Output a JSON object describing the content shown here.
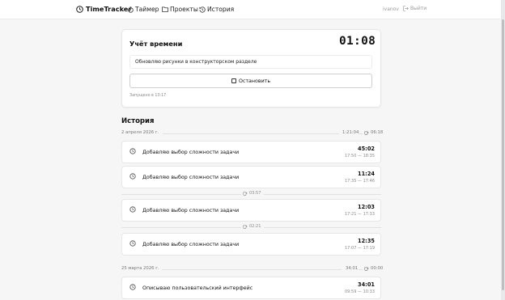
{
  "header": {
    "brand": "TimeTracker",
    "nav": {
      "timer": "Таймер",
      "projects": "Проекты",
      "history": "История"
    },
    "user": "ivanov",
    "logout": "Выйти"
  },
  "timer_card": {
    "title": "Учёт времени",
    "clock": "01:08",
    "description_value": "Обновляю рисунки в конструкторском разделе",
    "stop_label": "Остановить",
    "started_at": "Запущено в 13:17"
  },
  "history": {
    "title": "История",
    "days": [
      {
        "date": "2 апреля 2026 г.",
        "total": "1:21:04",
        "break_total": "06:18",
        "entries": [
          {
            "task": "Добавляю выбор сложности задачи",
            "duration": "45:02",
            "range": "17:50 — 18:35"
          },
          {
            "task": "Добавляю выбор сложности задачи",
            "duration": "11:24",
            "range": "17:35 — 17:46"
          },
          {
            "break": "03:57"
          },
          {
            "task": "Добавляю выбор сложности задачи",
            "duration": "12:03",
            "range": "17:21 — 17:33"
          },
          {
            "break": "02:21"
          },
          {
            "task": "Добавляю выбор сложности задачи",
            "duration": "12:35",
            "range": "17:07 — 17:19"
          }
        ]
      },
      {
        "date": "25 марта 2026 г.",
        "total": "34:01",
        "break_total": "00:00",
        "entries": [
          {
            "task": "Описываю пользовательский интерфейс",
            "duration": "34:01",
            "range": "09:59 — 10:33"
          }
        ]
      }
    ]
  },
  "colors": {
    "background": "#f6f6f7",
    "card": "#ffffff",
    "border": "#e5e5e8",
    "muted_text": "#8a8a90"
  },
  "icons": {
    "brand": "clock-icon",
    "timer": "stopwatch-icon",
    "projects": "folder-icon",
    "history": "history-icon",
    "logout": "logout-icon",
    "stop": "stop-square-icon",
    "entry": "clock-icon",
    "break": "coffee-cup-icon"
  }
}
